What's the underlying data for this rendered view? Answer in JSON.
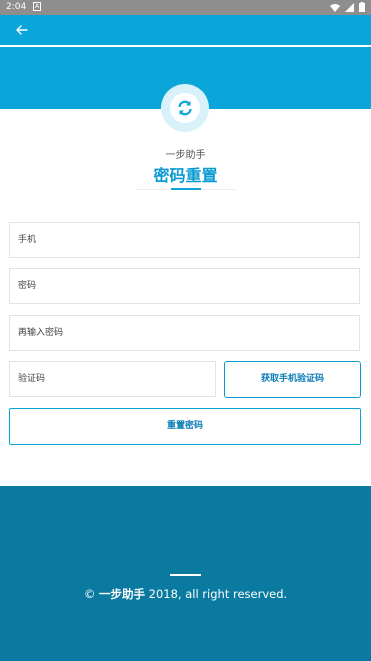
{
  "status_bar": {
    "time": "2:04",
    "notification_letter": "A"
  },
  "header": {
    "subtitle": "一步助手",
    "title": "密码重置"
  },
  "form": {
    "phone_placeholder": "手机",
    "password_placeholder": "密码",
    "confirm_password_placeholder": "再输入密码",
    "code_placeholder": "验证码",
    "get_code_label": "获取手机验证码",
    "submit_label": "重置密码"
  },
  "footer": {
    "copyright_symbol": "©",
    "brand": "一步助手",
    "text": "2018, all right reserved."
  },
  "colors": {
    "primary": "#0aa5d9",
    "footer": "#0a7aa0",
    "accent_text": "#0a7db5"
  },
  "icons": {
    "back": "arrow-left-icon",
    "refresh": "refresh-icon",
    "wifi": "wifi-icon",
    "signal": "signal-icon",
    "battery": "battery-icon"
  }
}
